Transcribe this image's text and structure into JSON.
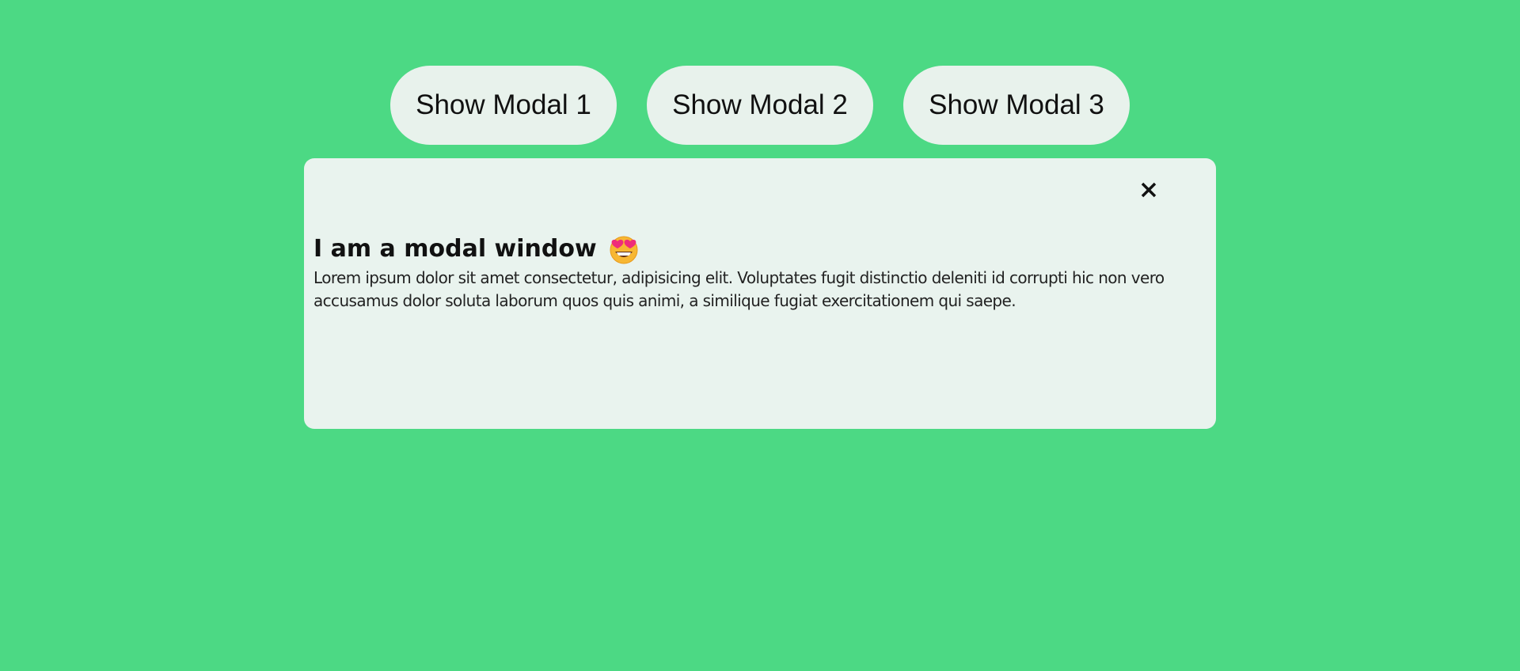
{
  "buttons": [
    {
      "label": "Show Modal 1"
    },
    {
      "label": "Show Modal 2"
    },
    {
      "label": "Show Modal 3"
    }
  ],
  "modal": {
    "close_icon": "close-icon",
    "title": "I am a modal window",
    "title_emoji": "heart-eyes-emoji-icon",
    "body": "Lorem ipsum dolor sit amet consectetur, adipisicing elit. Voluptates fugit distinctio deleniti id corrupti hic non vero accusamus dolor soluta laborum quos quis animi, a similique fugiat exercitationem qui saepe."
  },
  "colors": {
    "background": "#4cd984",
    "modal_background": "#e9f3ee",
    "button_background": "#e8f2ec",
    "text": "#111111"
  }
}
